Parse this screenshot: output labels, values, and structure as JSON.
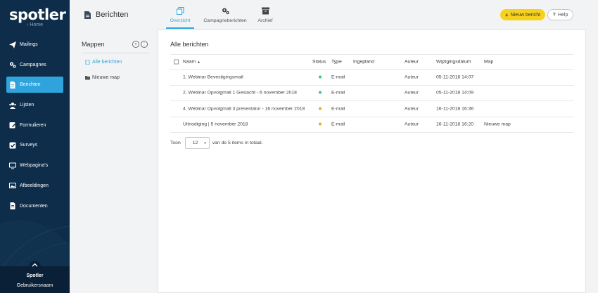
{
  "sidebar": {
    "logo": "spotler",
    "home": "‹ Home",
    "items": [
      {
        "label": "Mailings",
        "icon": "paper-plane-icon"
      },
      {
        "label": "Campagnes",
        "icon": "gears-icon"
      },
      {
        "label": "Berichten",
        "icon": "document-icon",
        "active": true
      },
      {
        "label": "Lijsten",
        "icon": "users-icon"
      },
      {
        "label": "Formulieren",
        "icon": "edit-icon"
      },
      {
        "label": "Surveys",
        "icon": "check-square-icon"
      },
      {
        "label": "Webpagina's",
        "icon": "monitor-icon"
      },
      {
        "label": "Afbeeldingen",
        "icon": "image-icon"
      },
      {
        "label": "Documenten",
        "icon": "file-icon"
      }
    ],
    "footer": {
      "name": "Spotler",
      "user": "Gebruikersnaam"
    }
  },
  "header": {
    "title": "Berichten",
    "tabs": [
      {
        "label": "Overzicht",
        "icon": "copy-icon",
        "active": true
      },
      {
        "label": "Campagneberichten",
        "icon": "gears-icon"
      },
      {
        "label": "Archief",
        "icon": "archive-icon"
      }
    ],
    "new_button": "Nieuw bericht",
    "help_button": "Help"
  },
  "folders": {
    "title": "Mappen",
    "add_symbol": "+",
    "more_symbol": "⋮",
    "items": [
      {
        "label": "Alle berichten",
        "active": true
      },
      {
        "label": "Nieuwe map"
      }
    ]
  },
  "main": {
    "title": "Alle berichten",
    "columns": {
      "name": "Naam",
      "sort_indicator": "▲",
      "status": "Status",
      "type": "Type",
      "scheduled": "Ingepland",
      "author": "Auteur",
      "modified": "Wijzigingsdatum",
      "folder": "Map"
    },
    "rows": [
      {
        "name": "1. Webinar Bevestigingsmail",
        "status": "green",
        "type": "E-mail",
        "scheduled": "",
        "author": "Auteur",
        "modified": "05-11-2018 14:07",
        "folder": ""
      },
      {
        "name": "2. Webinar Opvolgmail 1 Geslacht - 6 november 2018",
        "status": "green",
        "type": "E-mail",
        "scheduled": "",
        "author": "Auteur",
        "modified": "05-11-2018 14:09",
        "folder": ""
      },
      {
        "name": "4. Webinar Opvolgmail 3 presentator - 16 november 2018",
        "status": "orange",
        "type": "E-mail",
        "scheduled": "",
        "author": "Auteur",
        "modified": "16-11-2018 16:36",
        "folder": ""
      },
      {
        "name": "Uitnodiging | 5 november 2018",
        "status": "orange",
        "type": "E-mail",
        "scheduled": "",
        "author": "Auteur",
        "modified": "16-11-2018 16:20",
        "folder": "Nieuwe map"
      }
    ],
    "pager": {
      "prefix": "Toon",
      "page_size": "12",
      "caret": "▾",
      "suffix": "van de 5 items in totaal."
    }
  },
  "colors": {
    "sidebar_bg": "#0e2d4a",
    "accent": "#2fa3dc",
    "primary_button": "#f7d21c",
    "status_green": "#2ecc71",
    "status_orange": "#f5a623"
  }
}
